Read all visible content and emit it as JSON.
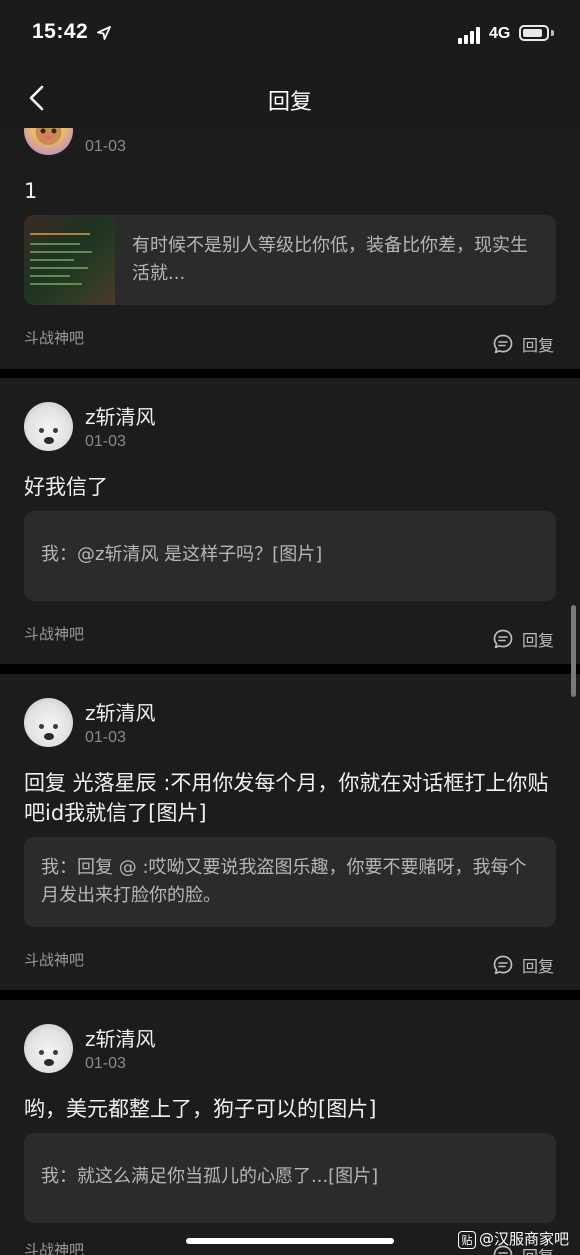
{
  "status_bar": {
    "time": "15:42",
    "network": "4G",
    "battery_level": 0.85
  },
  "nav": {
    "title": "回复"
  },
  "cards": [
    {
      "date": "01-03",
      "content": "1",
      "quote": "有时候不是别人等级比你低，装备比你差，现实生活就...",
      "forum": "斗战神吧",
      "reply_label": "回复"
    },
    {
      "username": "z斩清风",
      "date": "01-03",
      "content": "好我信了",
      "quote": "我：@z斩清风 是这样子吗？[图片]",
      "forum": "斗战神吧",
      "reply_label": "回复"
    },
    {
      "username": "z斩清风",
      "date": "01-03",
      "content": "回复 光落星辰 :不用你发每个月，你就在对话框打上你贴吧id我就信了[图片]",
      "quote": "我：回复 @ :哎呦又要说我盗图乐趣，你要不要赌呀，我每个月发出来打脸你的脸。",
      "forum": "斗战神吧",
      "reply_label": "回复"
    },
    {
      "username": "z斩清风",
      "date": "01-03",
      "content": "哟，美元都整上了，狗子可以的[图片]",
      "quote": "我：就这么满足你当孤儿的心愿了...[图片]",
      "forum": "斗战神吧",
      "reply_label": "回复"
    }
  ],
  "watermark": {
    "icon_text": "贴",
    "text": "@汉服商家吧"
  }
}
